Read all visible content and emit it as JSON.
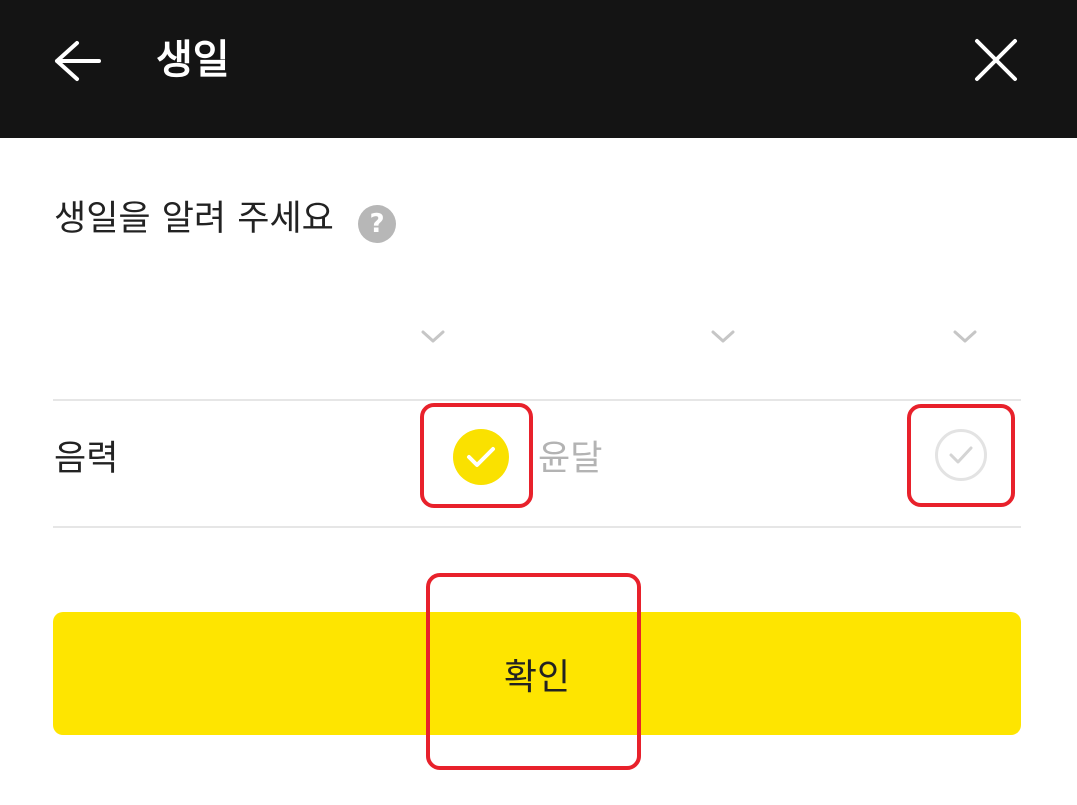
{
  "header": {
    "title": "생일",
    "back_icon": "arrow-left-icon",
    "close_icon": "close-icon",
    "background": "#141414"
  },
  "prompt": {
    "text": "생일을 알려 주세요",
    "help_icon": "question-mark-icon",
    "help_glyph": "?"
  },
  "date_selectors": [
    {
      "icon": "chevron-down-icon"
    },
    {
      "icon": "chevron-down-icon"
    },
    {
      "icon": "chevron-down-icon"
    }
  ],
  "calendar_row": {
    "label": "음력",
    "lunar_checkbox": {
      "checked": true,
      "icon": "check-icon",
      "color": "#fae100"
    },
    "leap_month_label": "윤달",
    "leap_month_checkbox": {
      "checked": false,
      "icon": "check-icon"
    }
  },
  "confirm_button": {
    "label": "확인",
    "color": "#fee500"
  },
  "highlight_color": "#e8212b"
}
